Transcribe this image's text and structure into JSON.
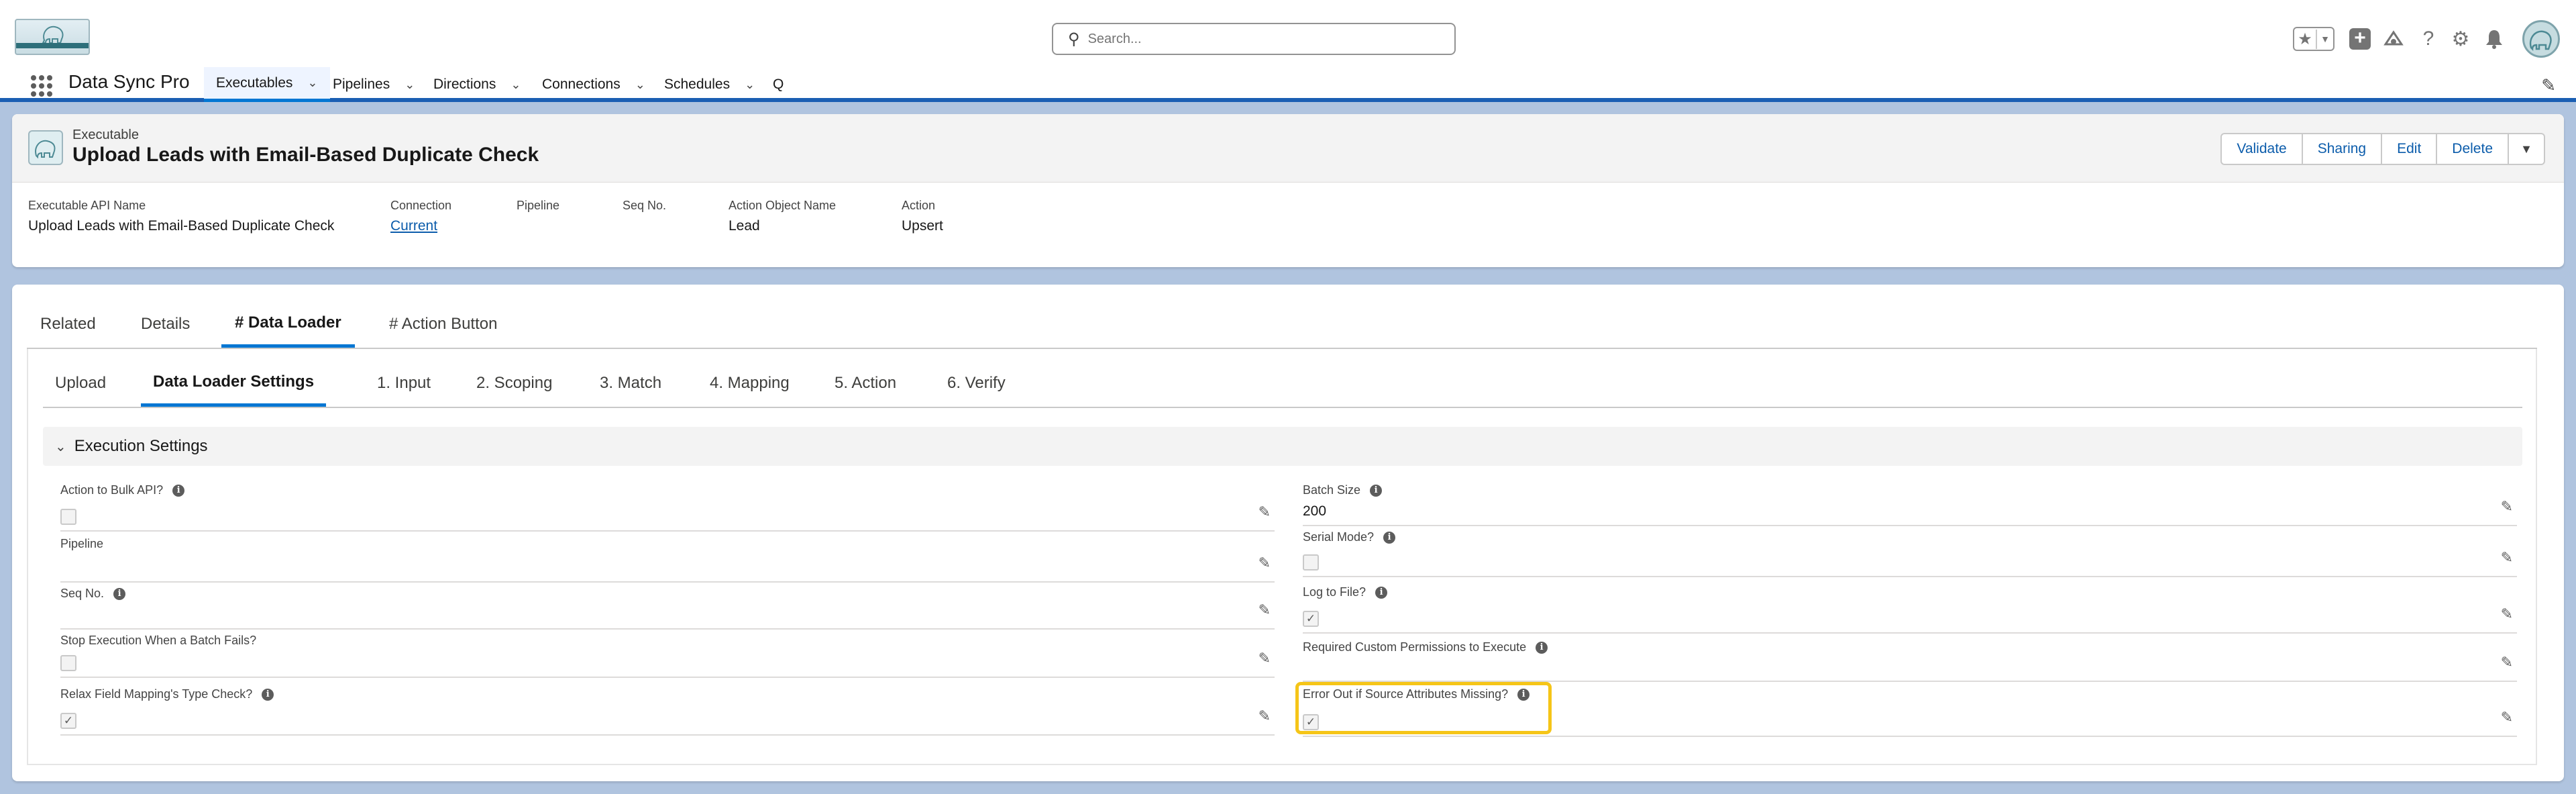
{
  "header": {
    "search_placeholder": "Search...",
    "icons": [
      "star-icon",
      "add-icon",
      "trailhead-icon",
      "help-icon",
      "gear-icon",
      "bell-icon",
      "avatar"
    ]
  },
  "nav": {
    "app_name": "Data Sync Pro",
    "items": [
      {
        "label": "Executables",
        "active": true
      },
      {
        "label": "Pipelines"
      },
      {
        "label": "Directions"
      },
      {
        "label": "Connections"
      },
      {
        "label": "Schedules"
      },
      {
        "label": "Q"
      }
    ]
  },
  "record": {
    "type": "Executable",
    "title": "Upload Leads with Email-Based Duplicate Check",
    "actions": [
      "Validate",
      "Sharing",
      "Edit",
      "Delete"
    ],
    "highlights": [
      {
        "label": "Executable API Name",
        "value": "Upload Leads with Email-Based Duplicate Check"
      },
      {
        "label": "Connection",
        "value": "Current"
      },
      {
        "label": "Pipeline",
        "value": ""
      },
      {
        "label": "Seq No.",
        "value": ""
      },
      {
        "label": "Action Object Name",
        "value": "Lead"
      },
      {
        "label": "Action",
        "value": "Upsert"
      }
    ]
  },
  "outer_tabs": [
    "Related",
    "Details",
    "# Data Loader",
    "# Action Button"
  ],
  "inner_tabs": [
    "Upload",
    "Data Loader Settings",
    "1. Input",
    "2. Scoping",
    "3. Match",
    "4. Mapping",
    "5. Action",
    "6. Verify"
  ],
  "section": {
    "title": "Execution Settings",
    "left_fields": [
      {
        "label": "Action to Bulk API?",
        "type": "checkbox",
        "checked": false,
        "info": true
      },
      {
        "label": "Pipeline",
        "type": "text",
        "value": ""
      },
      {
        "label": "Seq No.",
        "type": "text",
        "value": "",
        "info": true
      },
      {
        "label": "Stop Execution When a Batch Fails?",
        "type": "checkbox",
        "checked": false
      },
      {
        "label": "Relax Field Mapping's Type Check?",
        "type": "checkbox",
        "checked": true,
        "info": true
      }
    ],
    "right_fields": [
      {
        "label": "Batch Size",
        "type": "text",
        "value": "200",
        "info": true
      },
      {
        "label": "Serial Mode?",
        "type": "checkbox",
        "checked": false,
        "info": true
      },
      {
        "label": "Log to File?",
        "type": "checkbox",
        "checked": true,
        "info": true
      },
      {
        "label": "Required Custom Permissions to Execute",
        "type": "text",
        "value": "",
        "info": true
      },
      {
        "label": "Error Out if Source Attributes Missing?",
        "type": "checkbox",
        "checked": true,
        "info": true
      }
    ]
  },
  "colors": {
    "brand": "#0176d3",
    "highlight": "#f5c518",
    "page_bg": "#b0c4df"
  }
}
